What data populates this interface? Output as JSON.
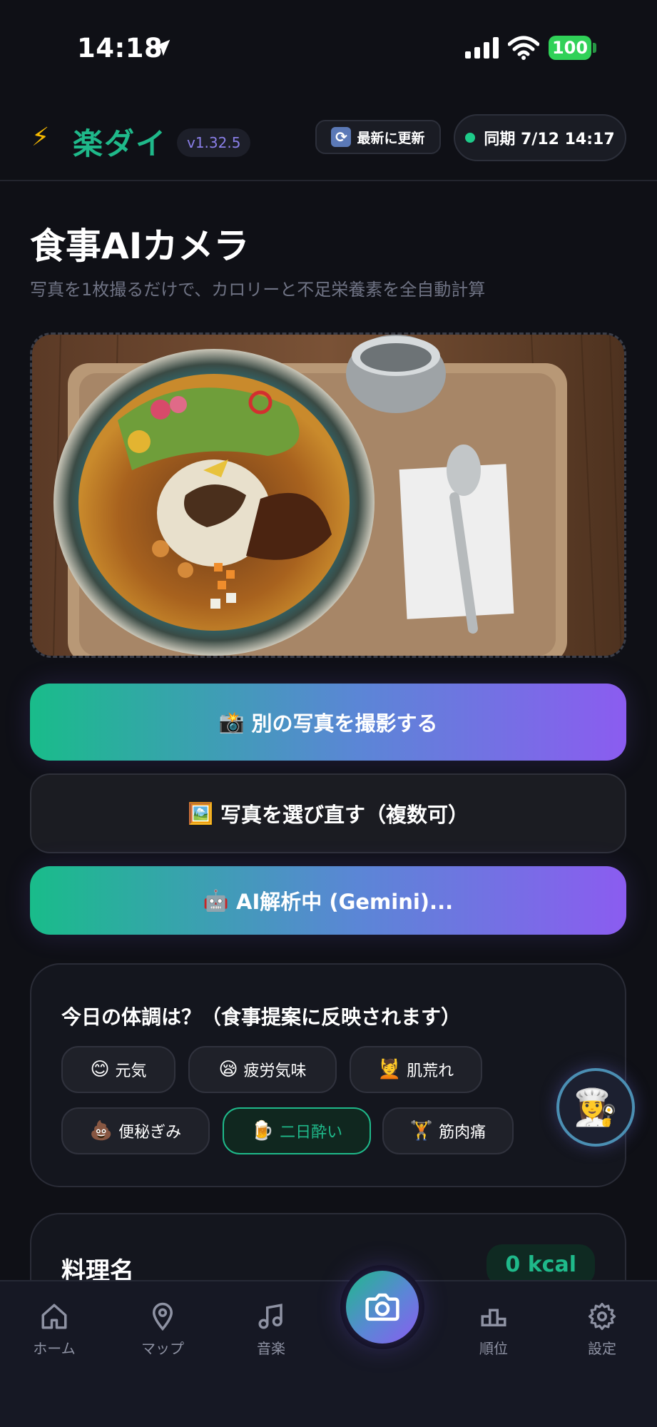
{
  "status_bar": {
    "time": "14:18",
    "battery": "100"
  },
  "header": {
    "bolt": "⚡",
    "app_name": "楽ダイ",
    "version": "v1.32.5",
    "refresh_label": "最新に更新",
    "sync_label": "同期 7/12 14:17"
  },
  "page": {
    "title": "食事AIカメラ",
    "subtitle": "写真を1枚撮るだけで、カロリーと不足栄養素を全自動計算"
  },
  "actions": {
    "take_photo": {
      "emoji": "📸",
      "label": "別の写真を撮影する"
    },
    "choose_photo": {
      "emoji": "🖼️",
      "label": "写真を選び直す（複数可）"
    },
    "ai_analyzing": {
      "emoji": "🤖",
      "label": "AI解析中 (Gemini)..."
    }
  },
  "condition": {
    "title": "今日の体調は？（食事提案に反映されます）",
    "chips": [
      {
        "emoji": "😊",
        "label": "元気",
        "active": false
      },
      {
        "emoji": "😪",
        "label": "疲労気味",
        "active": false
      },
      {
        "emoji": "💆",
        "label": "肌荒れ",
        "active": false
      },
      {
        "emoji": "💩",
        "label": "便秘ぎみ",
        "active": false
      },
      {
        "emoji": "🍺",
        "label": "二日酔い",
        "active": true
      },
      {
        "emoji": "🏋️",
        "label": "筋肉痛",
        "active": false
      }
    ]
  },
  "chef_fab": {
    "emoji": "👩‍🍳",
    "icon": "chef-icon"
  },
  "dish": {
    "label": "料理名",
    "kcal": "0 kcal"
  },
  "bottom_nav": {
    "items": [
      {
        "label": "ホーム",
        "icon": "home-icon"
      },
      {
        "label": "マップ",
        "icon": "map-pin-icon"
      },
      {
        "label": "音楽",
        "icon": "music-note-icon"
      },
      {
        "label": "順位",
        "icon": "ranking-podium-icon"
      },
      {
        "label": "設定",
        "icon": "gear-icon"
      }
    ],
    "center_icon": "camera-icon"
  },
  "colors": {
    "background": "#0f1016",
    "accent_green": "#1fb98a",
    "accent_purple": "#8b5cf0",
    "version_text": "#8a7fe8"
  }
}
